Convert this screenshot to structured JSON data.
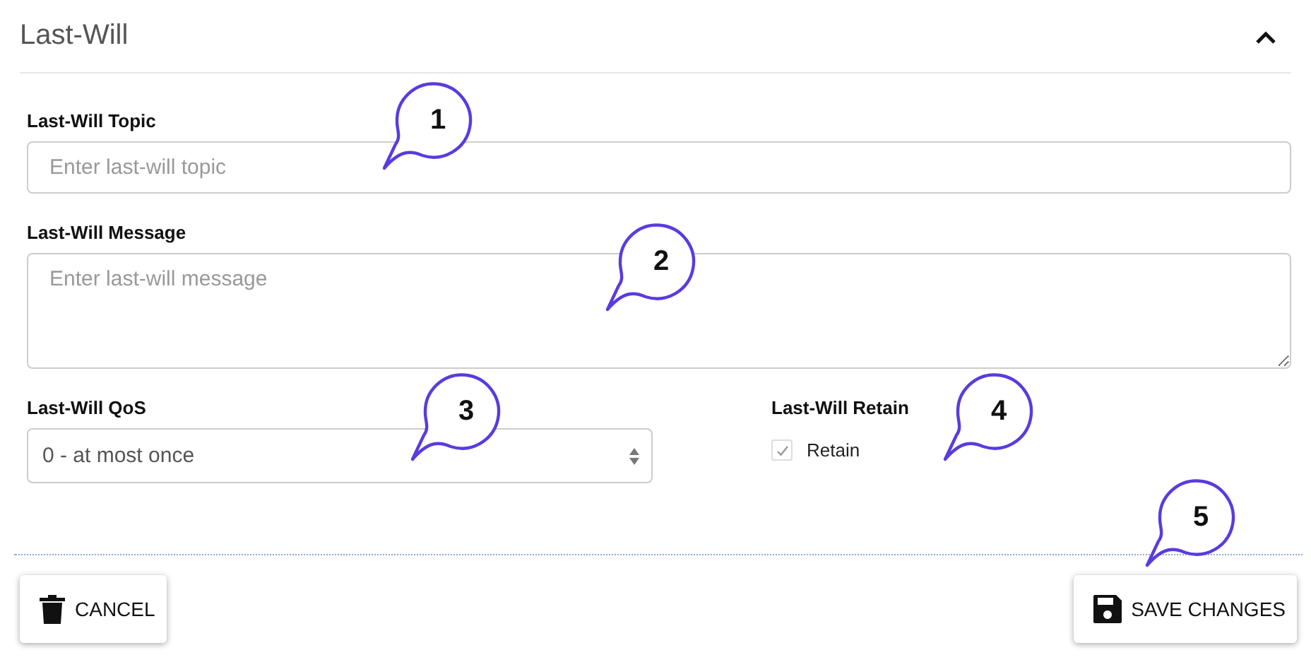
{
  "panel": {
    "title": "Last-Will",
    "expanded": true
  },
  "topic": {
    "label": "Last-Will Topic",
    "placeholder": "Enter last-will topic"
  },
  "message": {
    "label": "Last-Will Message",
    "placeholder": "Enter last-will message"
  },
  "qos": {
    "label": "Last-Will QoS",
    "value": "0 - at most once"
  },
  "retain": {
    "label": "Last-Will Retain",
    "option": "Retain",
    "checked": true
  },
  "buttons": [
    {
      "kind": "cancel",
      "label": "CANCEL"
    },
    {
      "kind": "save",
      "label": "SAVE CHANGES"
    }
  ],
  "callouts": [
    "1",
    "2",
    "3",
    "4",
    "5"
  ]
}
